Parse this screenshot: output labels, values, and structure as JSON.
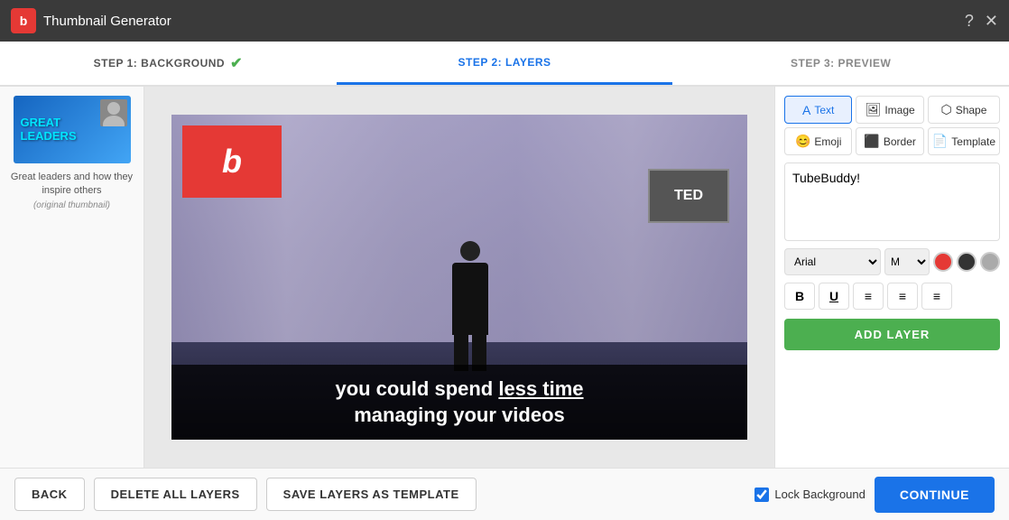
{
  "titlebar": {
    "logo": "b",
    "title": "Thumbnail Generator",
    "help_icon": "?",
    "close_icon": "✕"
  },
  "steps": [
    {
      "id": "step1",
      "label": "STEP 1: BACKGROUND",
      "completed": true
    },
    {
      "id": "step2",
      "label": "STEP 2: LAYERS",
      "active": true
    },
    {
      "id": "step3",
      "label": "STEP 3: PREVIEW",
      "active": false
    }
  ],
  "sidebar": {
    "caption": "Great leaders and how they inspire others",
    "caption_sub": "(original thumbnail)"
  },
  "canvas": {
    "ted_label": "TED",
    "caption_line1": "you could spend ",
    "caption_underline": "less time",
    "caption_line2": "managing your videos"
  },
  "right_panel": {
    "layer_buttons": [
      {
        "id": "text",
        "label": "Text",
        "icon": "A",
        "active": true
      },
      {
        "id": "image",
        "label": "Image",
        "icon": "🖼",
        "active": false
      },
      {
        "id": "shape",
        "label": "Shape",
        "icon": "⬡",
        "active": false
      },
      {
        "id": "emoji",
        "label": "Emoji",
        "icon": "😊",
        "active": false
      },
      {
        "id": "border",
        "label": "Border",
        "icon": "⬛",
        "active": false
      },
      {
        "id": "template",
        "label": "Template",
        "icon": "📄",
        "active": false
      }
    ],
    "text_content": "TubeBuddy!",
    "font": "Arial",
    "weight": "M",
    "add_layer_label": "ADD LAYER"
  },
  "footer": {
    "back_label": "BACK",
    "delete_label": "DELETE ALL LAYERS",
    "save_label": "SAVE LAYERS AS TEMPLATE",
    "lock_label": "Lock Background",
    "continue_label": "CONTINUE"
  }
}
